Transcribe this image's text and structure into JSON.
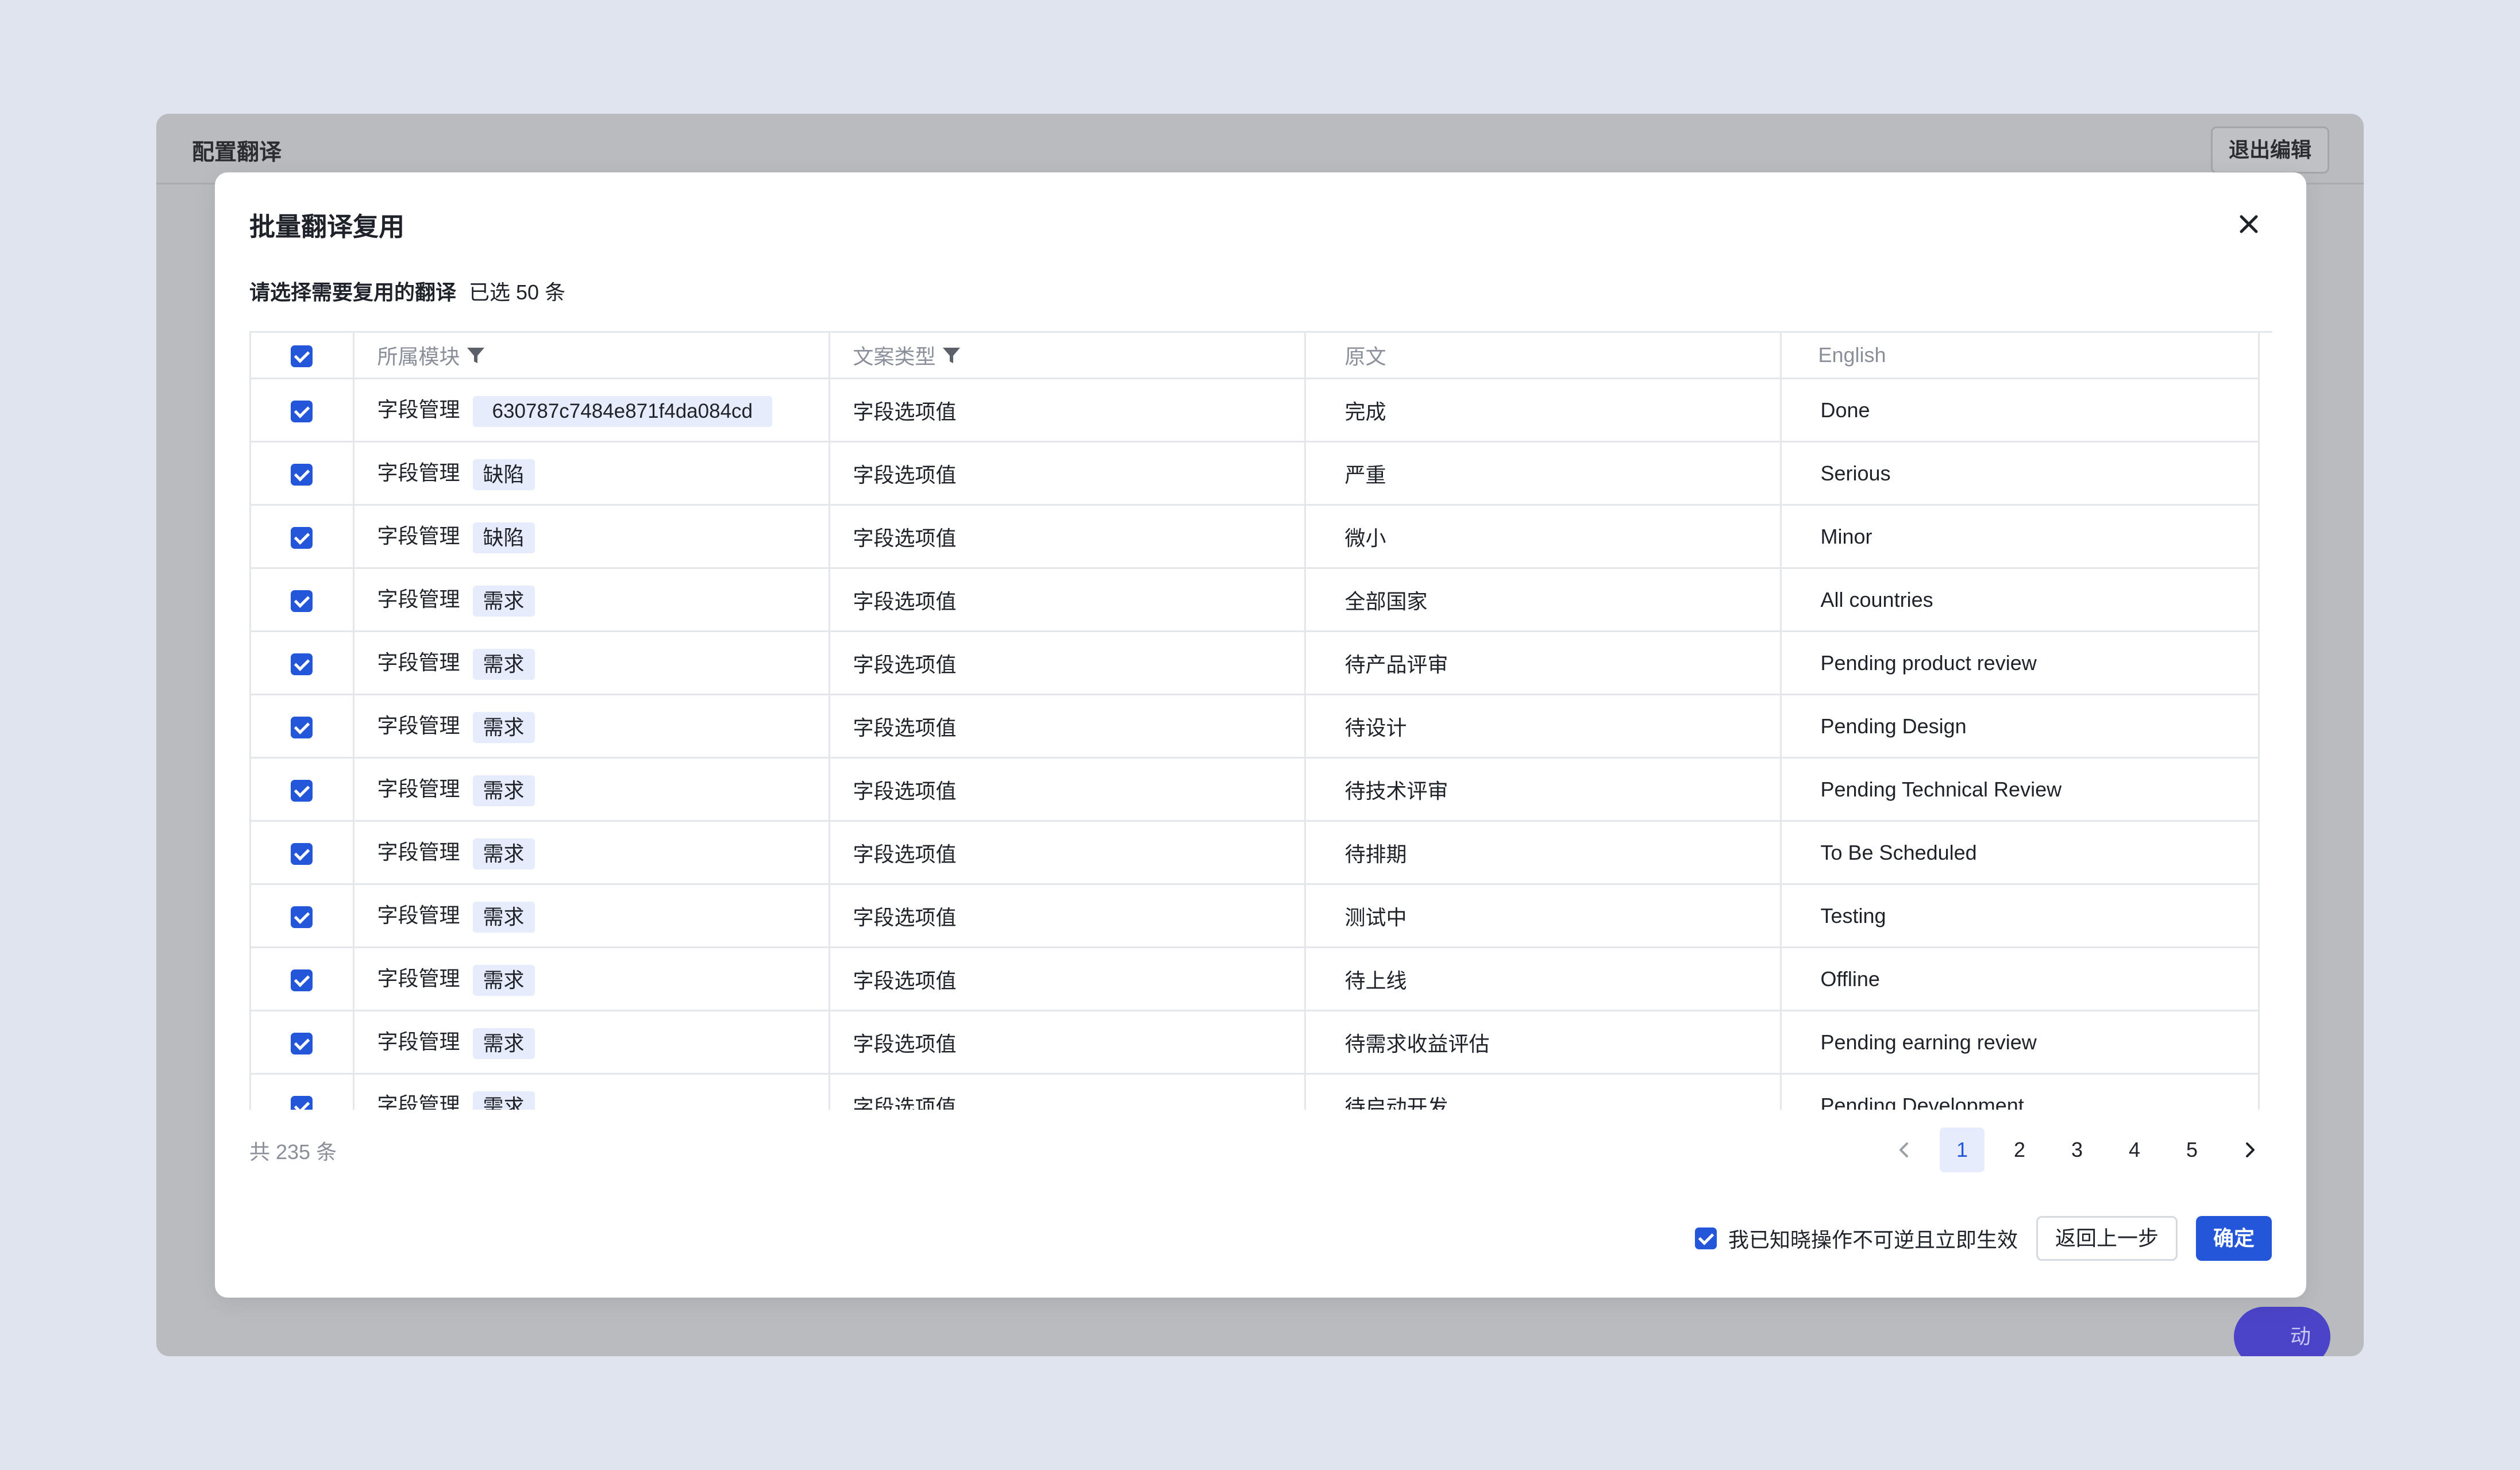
{
  "background": {
    "title": "配置翻译",
    "exit_button": "退出编辑",
    "fab_label": "动"
  },
  "modal": {
    "title": "批量翻译复用",
    "instruction": "请选择需要复用的翻译",
    "selected_text": "已选 50 条",
    "columns": [
      "所属模块",
      "文案类型",
      "原文",
      "English"
    ],
    "rows": [
      {
        "module": "字段管理",
        "tag": "630787c7484e871f4da084cd",
        "type": "字段选项值",
        "original": "完成",
        "english": "Done"
      },
      {
        "module": "字段管理",
        "tag": "缺陷",
        "type": "字段选项值",
        "original": "严重",
        "english": "Serious"
      },
      {
        "module": "字段管理",
        "tag": "缺陷",
        "type": "字段选项值",
        "original": "微小",
        "english": "Minor"
      },
      {
        "module": "字段管理",
        "tag": "需求",
        "type": "字段选项值",
        "original": "全部国家",
        "english": "All countries"
      },
      {
        "module": "字段管理",
        "tag": "需求",
        "type": "字段选项值",
        "original": "待产品评审",
        "english": "Pending product review"
      },
      {
        "module": "字段管理",
        "tag": "需求",
        "type": "字段选项值",
        "original": "待设计",
        "english": "Pending Design"
      },
      {
        "module": "字段管理",
        "tag": "需求",
        "type": "字段选项值",
        "original": "待技术评审",
        "english": "Pending Technical Review"
      },
      {
        "module": "字段管理",
        "tag": "需求",
        "type": "字段选项值",
        "original": "待排期",
        "english": "To Be Scheduled"
      },
      {
        "module": "字段管理",
        "tag": "需求",
        "type": "字段选项值",
        "original": "测试中",
        "english": "Testing"
      },
      {
        "module": "字段管理",
        "tag": "需求",
        "type": "字段选项值",
        "original": "待上线",
        "english": "Offline"
      },
      {
        "module": "字段管理",
        "tag": "需求",
        "type": "字段选项值",
        "original": "待需求收益评估",
        "english": "Pending earning review"
      },
      {
        "module": "字段管理",
        "tag": "需求",
        "type": "字段选项值",
        "original": "待启动开发",
        "english": "Pending Development"
      }
    ],
    "total": "共 235 条",
    "pages": [
      "1",
      "2",
      "3",
      "4",
      "5"
    ],
    "current_page": "1",
    "acknowledge": "我已知晓操作不可逆且立即生效",
    "back_button": "返回上一步",
    "confirm_button": "确定"
  },
  "colors": {
    "primary": "#2456d9",
    "tag_bg": "#e6ecfb",
    "page_bg": "#dfe4ee"
  }
}
